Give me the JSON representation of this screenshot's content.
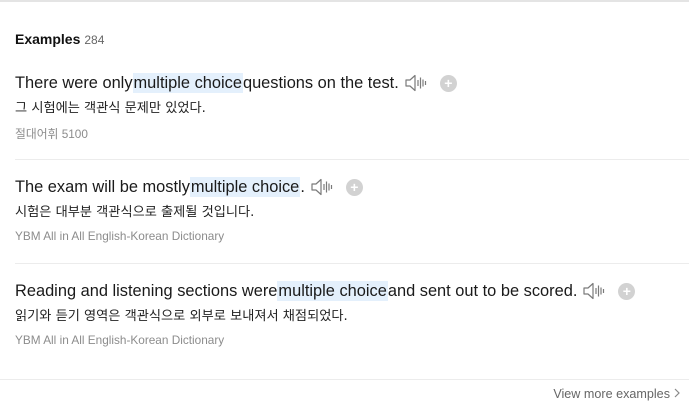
{
  "section": {
    "title": "Examples",
    "count": "284"
  },
  "examples": [
    {
      "en_before": "There were only ",
      "en_highlight": "multiple choice",
      "en_after": " questions on the test.",
      "ko": "그 시험에는 객관식 문제만 있었다.",
      "source": "절대어휘 5100"
    },
    {
      "en_before": "The exam will be mostly ",
      "en_highlight": "multiple choice",
      "en_after": ".",
      "ko": "시험은 대부분 객관식으로 출제될 것입니다.",
      "source": "YBM All in All English-Korean Dictionary"
    },
    {
      "en_before": "Reading and listening sections were ",
      "en_highlight": "multiple choice",
      "en_after": " and sent out to be scored.",
      "ko": "읽기와 듣기 영역은 객관식으로 외부로 보내져서 채점되었다.",
      "source": "YBM All in All English-Korean Dictionary"
    }
  ],
  "footer": {
    "view_more": "View more examples"
  },
  "icons": {
    "audio": "speaker-icon",
    "add": "plus-icon",
    "more": "chevron-right-icon"
  },
  "colors": {
    "highlight": "#e4f0fc",
    "plus_button": "#d2d2d2"
  }
}
